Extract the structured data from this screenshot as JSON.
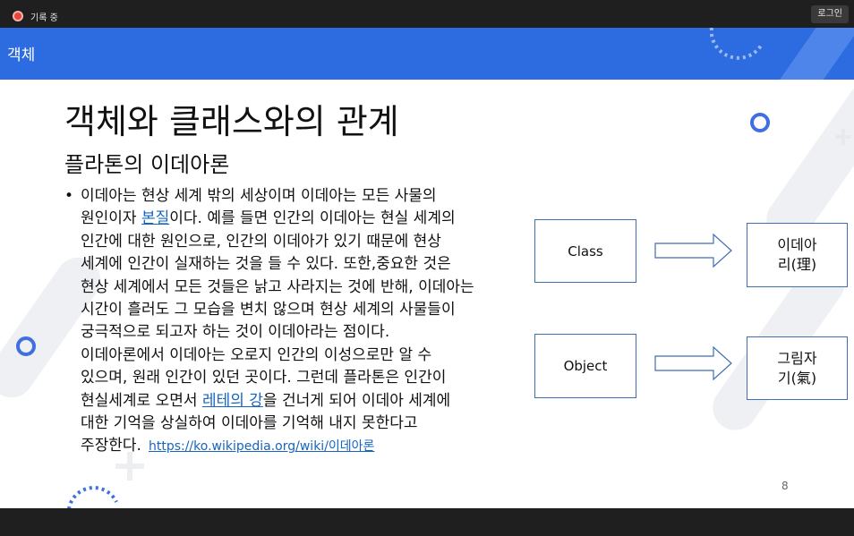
{
  "topbar": {
    "recording_label": "기록 중",
    "login_label": "로그인"
  },
  "slide": {
    "header_title": "객체",
    "title": "객체와 클래스와의 관계",
    "subtitle": "플라톤의 이데아론",
    "bullet": "•",
    "body_lines": [
      [
        "이데아는 현상 세계 밖의 세상이며 이데아는 모든 사물의"
      ],
      [
        "원인이자 ",
        {
          "link": "본질"
        },
        "이다. 예를 들면 인간의 이데아는 현실 세계의"
      ],
      [
        "인간에 대한 원인으로, 인간의 이데아가 있기 때문에 현상"
      ],
      [
        "세계에 인간이 실재하는 것을 들 수 있다. 또한,중요한 것은"
      ],
      [
        "현상 세계에서 모든 것들은 낡고 사라지는 것에 반해, 이데아는"
      ],
      [
        "시간이 흘러도 그 모습을 변치 않으며 현상 세계의 사물들이"
      ],
      [
        "궁극적으로 되고자 하는 것이 이데아라는 점이다."
      ],
      [
        "이데아론에서 이데아는 오로지 인간의 이성으로만 알 수"
      ],
      [
        "있으며, 원래 인간이 있던 곳이다. 그런데 플라톤은 인간이"
      ],
      [
        "현실세계로 오면서 ",
        {
          "link": "레테의 강"
        },
        "을 건너게 되어 이데아 세계에"
      ],
      [
        "대한 기억을 상실하여 이데아를 기억해 내지 못한다고"
      ]
    ],
    "last_line_text": "주장한다.",
    "wiki_link": "https://ko.wikipedia.org/wiki/이데아론",
    "diagram": {
      "class_label": "Class",
      "object_label": "Object",
      "idea_line1": "이데아",
      "idea_line2": "리(理)",
      "shadow_line1": "그림자",
      "shadow_line2": "기(氣)"
    },
    "page_number": "8"
  },
  "colors": {
    "header_blue": "#2c6be0",
    "box_border": "#3f6fb0",
    "link_blue": "#1565c0",
    "accent_blue": "#3f6fe0"
  }
}
